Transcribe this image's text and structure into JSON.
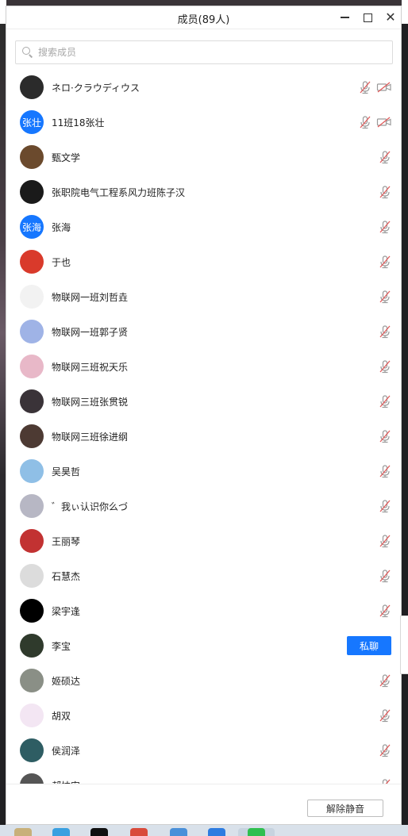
{
  "window": {
    "title": "成员(89人)",
    "controls": [
      "minimize",
      "maximize",
      "close"
    ]
  },
  "search": {
    "placeholder": "搜索成员",
    "icon": "search-icon"
  },
  "members": [
    {
      "name": "ネロ·クラウディウス",
      "avatar_color": "#2b2b2b",
      "avatar_text": "",
      "mic_muted": true,
      "camera_off": true
    },
    {
      "name": "11班18张壮",
      "avatar_color": "#1677ff",
      "avatar_text": "张壮",
      "mic_muted": true,
      "camera_off": true
    },
    {
      "name": "甄文学",
      "avatar_color": "#6b4a2d",
      "avatar_text": "",
      "mic_muted": true
    },
    {
      "name": "张职院电气工程系风力班陈子汉",
      "avatar_color": "#1a1a1a",
      "avatar_text": "",
      "mic_muted": true
    },
    {
      "name": "张海",
      "avatar_color": "#1677ff",
      "avatar_text": "张海",
      "mic_muted": true
    },
    {
      "name": "于也",
      "avatar_color": "#d93a2b",
      "avatar_text": "",
      "mic_muted": true
    },
    {
      "name": "物联网一班刘哲垚",
      "avatar_color": "#f2f2f2",
      "avatar_text": "",
      "mic_muted": true
    },
    {
      "name": "物联网一班郭子贤",
      "avatar_color": "#9fb3e6",
      "avatar_text": "",
      "mic_muted": true
    },
    {
      "name": "物联网三班祝天乐",
      "avatar_color": "#e8b8c8",
      "avatar_text": "",
      "mic_muted": true
    },
    {
      "name": "物联网三班张贯锐",
      "avatar_color": "#3a3338",
      "avatar_text": "",
      "mic_muted": true
    },
    {
      "name": "物联网三班徐进纲",
      "avatar_color": "#4d3a33",
      "avatar_text": "",
      "mic_muted": true
    },
    {
      "name": "吴昊哲",
      "avatar_color": "#8fbfe6",
      "avatar_text": "",
      "mic_muted": true
    },
    {
      "name": "゛我ぃ认识你么づ",
      "avatar_color": "#b7b7c4",
      "avatar_text": "",
      "mic_muted": true
    },
    {
      "name": "王丽琴",
      "avatar_color": "#c23232",
      "avatar_text": "",
      "mic_muted": true
    },
    {
      "name": "石慧杰",
      "avatar_color": "#dcdcdc",
      "avatar_text": "",
      "mic_muted": true
    },
    {
      "name": "梁宇逢",
      "avatar_color": "#000000",
      "avatar_text": "",
      "mic_muted": true
    },
    {
      "name": "李宝",
      "avatar_color": "#2f3a2c",
      "avatar_text": "",
      "mic_muted": false,
      "action_label": "私聊"
    },
    {
      "name": "姬硕达",
      "avatar_color": "#8a8f86",
      "avatar_text": "",
      "mic_muted": true
    },
    {
      "name": "胡双",
      "avatar_color": "#f3e6f3",
      "avatar_text": "",
      "mic_muted": true
    },
    {
      "name": "侯润泽",
      "avatar_color": "#2e5d63",
      "avatar_text": "",
      "mic_muted": true
    },
    {
      "name": "郝忱安",
      "avatar_color": "#555555",
      "avatar_text": "",
      "mic_muted": true
    }
  ],
  "footer": {
    "unmute_label": "解除静音"
  },
  "colors": {
    "accent": "#1677ff",
    "muted_icon": "#e05b5b"
  }
}
